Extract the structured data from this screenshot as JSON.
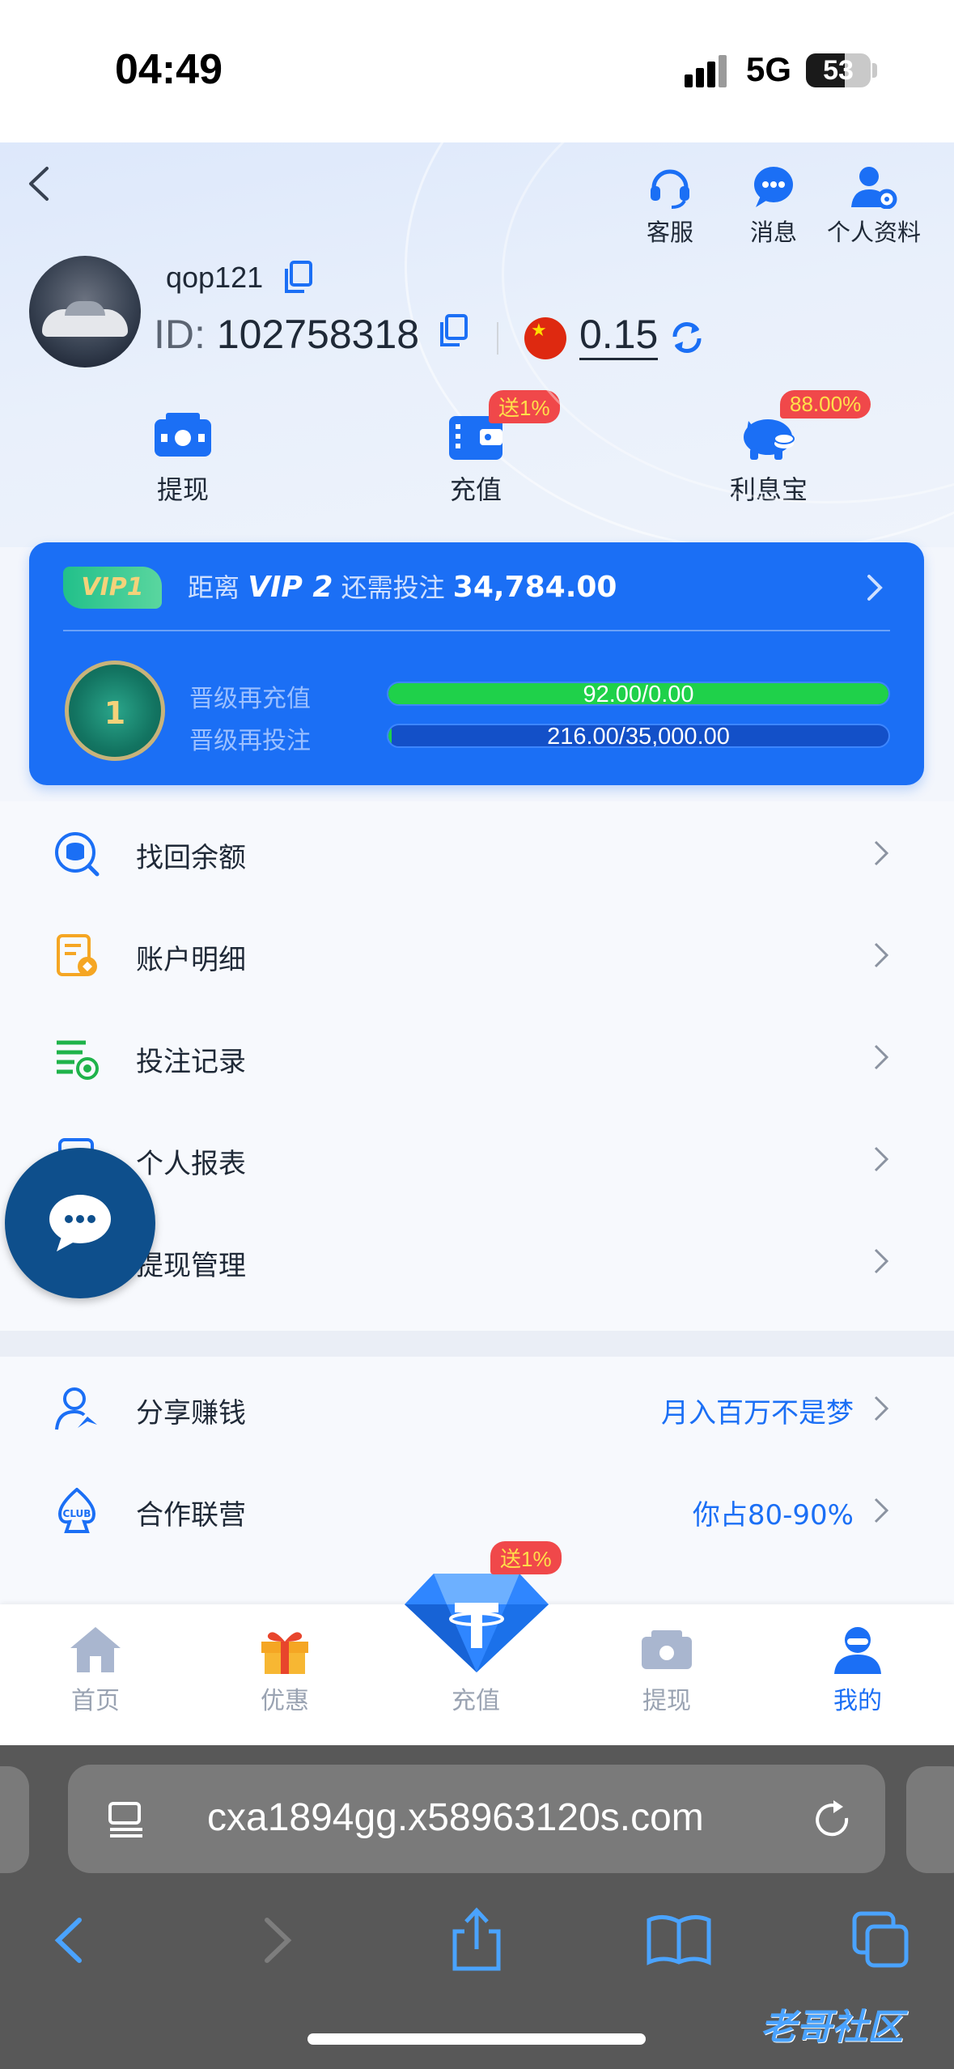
{
  "status_bar": {
    "time": "04:49",
    "network": "5G",
    "battery": "53"
  },
  "header": {
    "actions": [
      {
        "label": "客服",
        "icon": "headset-icon"
      },
      {
        "label": "消息",
        "icon": "chat-bubble-icon"
      },
      {
        "label": "个人资料",
        "icon": "user-settings-icon"
      }
    ]
  },
  "profile": {
    "username": "qop121",
    "id_prefix": "ID:",
    "id_value": "102758318",
    "balance": "0.15",
    "currency_flag": "china-flag-icon"
  },
  "quick_actions": [
    {
      "label": "提现",
      "icon": "withdraw-icon",
      "badge": ""
    },
    {
      "label": "充值",
      "icon": "wallet-icon",
      "badge": "送1%"
    },
    {
      "label": "利息宝",
      "icon": "piggy-bank-icon",
      "badge": "88.00%"
    }
  ],
  "vip": {
    "current_level": "VIP1",
    "prefix": "距离",
    "next_level": "VIP 2",
    "middle": "还需投注",
    "remaining": "34,784.00",
    "medal_level": "1",
    "recharge_label": "晋级再充值",
    "recharge_text": "92.00/0.00",
    "recharge_progress": 1.0,
    "bet_label": "晋级再投注",
    "bet_text": "216.00/35,000.00",
    "bet_progress": 0.006
  },
  "menu": [
    {
      "label": "找回余额",
      "icon": "database-search-icon",
      "color": "#1b6ff5"
    },
    {
      "label": "账户明细",
      "icon": "account-details-icon",
      "color": "#f5a623"
    },
    {
      "label": "投注记录",
      "icon": "bet-records-icon",
      "color": "#1fb34a"
    },
    {
      "label": "个人报表",
      "icon": "report-icon",
      "color": "#1b6ff5"
    },
    {
      "label": "提现管理",
      "icon": "withdraw-manage-icon",
      "color": "#1b6ff5"
    }
  ],
  "menu2": [
    {
      "label": "分享赚钱",
      "extra": "月入百万不是梦",
      "icon": "share-user-icon"
    },
    {
      "label": "合作联营",
      "extra": "你占80-90%",
      "icon": "club-spade-icon"
    }
  ],
  "tabbar": {
    "items": [
      {
        "label": "首页",
        "icon": "home-icon",
        "active": false
      },
      {
        "label": "优惠",
        "icon": "gift-icon",
        "active": false
      },
      {
        "label": "充值",
        "icon": "diamond-tether-icon",
        "active": false,
        "badge": "送1%"
      },
      {
        "label": "提现",
        "icon": "cash-icon",
        "active": false
      },
      {
        "label": "我的",
        "icon": "profile-icon",
        "active": true
      }
    ]
  },
  "browser": {
    "url": "cxa1894gg.x58963120s.com"
  },
  "colors": {
    "accent": "#1b6ff5",
    "badge": "#f0484a",
    "progress_green": "#1fd14a"
  }
}
